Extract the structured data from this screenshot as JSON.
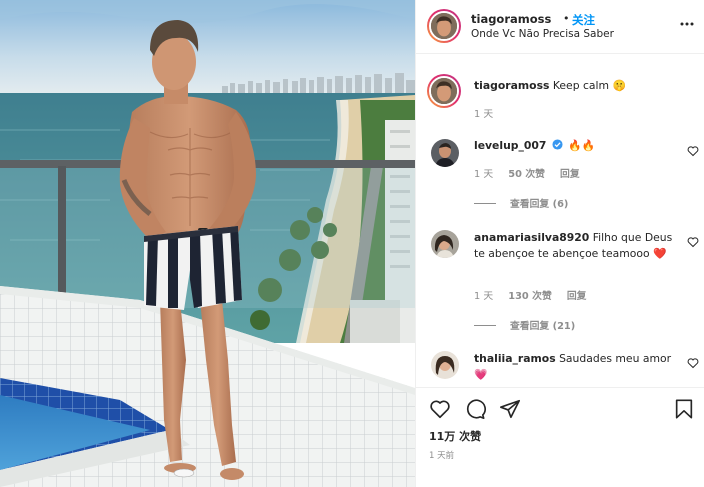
{
  "post": {
    "username": "tiagoramoss",
    "dot": "•",
    "follow_label": "关注",
    "location": "Onde Vc Não Precisa Saber",
    "more_icon": "more-dots-icon"
  },
  "caption": {
    "username": "tiagoramoss",
    "text": "Keep calm 🤫",
    "time": "1 天"
  },
  "comments": [
    {
      "username": "levelup_007",
      "text": "🔥🔥",
      "time": "1 天",
      "likes": "50 次赞",
      "reply_label": "回复",
      "view_replies": "查看回复 (6)"
    },
    {
      "username": "anamariasilva8920",
      "text": "Filho que Deus te abençoe te abençoe teamooo ❤️",
      "time": "1 天",
      "likes": "130 次赞",
      "reply_label": "回复",
      "view_replies": "查看回复 (21)"
    },
    {
      "username": "thaliia_ramos",
      "text": "Saudades meu amor💗",
      "time": "",
      "likes": "",
      "reply_label": "",
      "view_replies": ""
    }
  ],
  "footer": {
    "likes_count": "11万 次赞",
    "posted": "1 天前"
  },
  "colors": {
    "link_blue": "#0095f6",
    "text": "#262626",
    "muted": "#8e8e8e",
    "border": "#efefef",
    "verified": "#3897f0"
  }
}
